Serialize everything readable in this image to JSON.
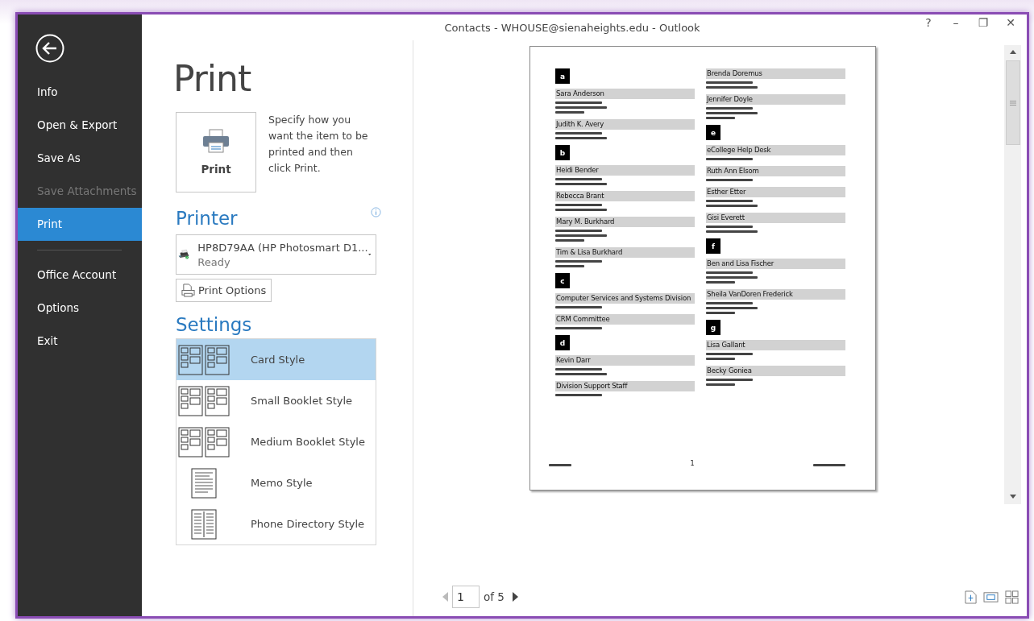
{
  "window": {
    "title": "Contacts - WHOUSE@sienaheights.edu - Outlook",
    "controls": [
      "?",
      "–",
      "❐",
      "✕"
    ]
  },
  "sidebar": {
    "items": [
      {
        "label": "Info",
        "selected": false,
        "disabled": false,
        "divider_after": false
      },
      {
        "label": "Open & Export",
        "selected": false,
        "disabled": false,
        "divider_after": false
      },
      {
        "label": "Save As",
        "selected": false,
        "disabled": false,
        "divider_after": false
      },
      {
        "label": "Save Attachments",
        "selected": false,
        "disabled": true,
        "divider_after": false
      },
      {
        "label": "Print",
        "selected": true,
        "disabled": false,
        "divider_after": true
      },
      {
        "label": "Office Account",
        "selected": false,
        "disabled": false,
        "divider_after": false
      },
      {
        "label": "Options",
        "selected": false,
        "disabled": false,
        "divider_after": false
      },
      {
        "label": "Exit",
        "selected": false,
        "disabled": false,
        "divider_after": false
      }
    ]
  },
  "heading": "Print",
  "print_button": {
    "label": "Print",
    "description": "Specify how you want the item to be printed and then click Print."
  },
  "printer": {
    "heading": "Printer",
    "name": "HP8D79AA (HP Photosmart D1...",
    "status": "Ready",
    "options_button": "Print Options"
  },
  "settings": {
    "heading": "Settings",
    "styles": [
      {
        "label": "Card Style",
        "kind": "cards",
        "selected": true
      },
      {
        "label": "Small Booklet Style",
        "kind": "cards",
        "selected": false
      },
      {
        "label": "Medium Booklet Style",
        "kind": "cards",
        "selected": false
      },
      {
        "label": "Memo Style",
        "kind": "memo",
        "selected": false
      },
      {
        "label": "Phone Directory Style",
        "kind": "phone",
        "selected": false
      }
    ]
  },
  "preview": {
    "columns": [
      {
        "entries": [
          {
            "kind": "letter",
            "text": "a"
          },
          {
            "kind": "contact",
            "name": "Sara Anderson",
            "email": true,
            "phone": true
          },
          {
            "kind": "contact",
            "name": "Judith K. Avery",
            "email": true,
            "phone": false
          },
          {
            "kind": "letter",
            "text": "b"
          },
          {
            "kind": "contact",
            "name": "Heidi Bender",
            "email": true,
            "phone": false
          },
          {
            "kind": "contact",
            "name": "Rebecca Brant",
            "email": true,
            "phone": false
          },
          {
            "kind": "contact",
            "name": "Mary M. Burkhard",
            "email": true,
            "phone": true
          },
          {
            "kind": "contact",
            "name": "Tim & Lisa Burkhard",
            "email": false,
            "phone": true
          },
          {
            "kind": "letter",
            "text": "c"
          },
          {
            "kind": "contact",
            "name": "Computer Services and Systems Division",
            "email": false,
            "phone": false
          },
          {
            "kind": "contact",
            "name": "CRM Committee",
            "email": false,
            "phone": false
          },
          {
            "kind": "letter",
            "text": "d"
          },
          {
            "kind": "contact",
            "name": "Kevin Darr",
            "email": true,
            "phone": false
          },
          {
            "kind": "contact",
            "name": "Division Support Staff",
            "email": false,
            "phone": false
          }
        ]
      },
      {
        "entries": [
          {
            "kind": "contact",
            "name": "Brenda Doremus",
            "email": true,
            "phone": false
          },
          {
            "kind": "contact",
            "name": "Jennifer Doyle",
            "email": true,
            "phone": true
          },
          {
            "kind": "letter",
            "text": "e"
          },
          {
            "kind": "contact",
            "name": "eCollege Help Desk",
            "email": false,
            "phone": false
          },
          {
            "kind": "contact",
            "name": "Ruth Ann Elsom",
            "email": false,
            "phone": false
          },
          {
            "kind": "contact",
            "name": "Esther Etter",
            "email": true,
            "phone": false
          },
          {
            "kind": "contact",
            "name": "Gisi Everett",
            "email": true,
            "phone": false
          },
          {
            "kind": "letter",
            "text": "f"
          },
          {
            "kind": "contact",
            "name": "Ben and Lisa Fischer",
            "email": true,
            "phone": true
          },
          {
            "kind": "contact",
            "name": "Sheila VanDoren Frederick",
            "email": true,
            "phone": true
          },
          {
            "kind": "letter",
            "text": "g"
          },
          {
            "kind": "contact",
            "name": "Lisa Gallant",
            "email": false,
            "phone": true
          },
          {
            "kind": "contact",
            "name": "Becky Goniea",
            "email": false,
            "phone": true
          }
        ]
      }
    ],
    "footer_page": "1"
  },
  "pager": {
    "page": "1",
    "total": "of 5"
  }
}
